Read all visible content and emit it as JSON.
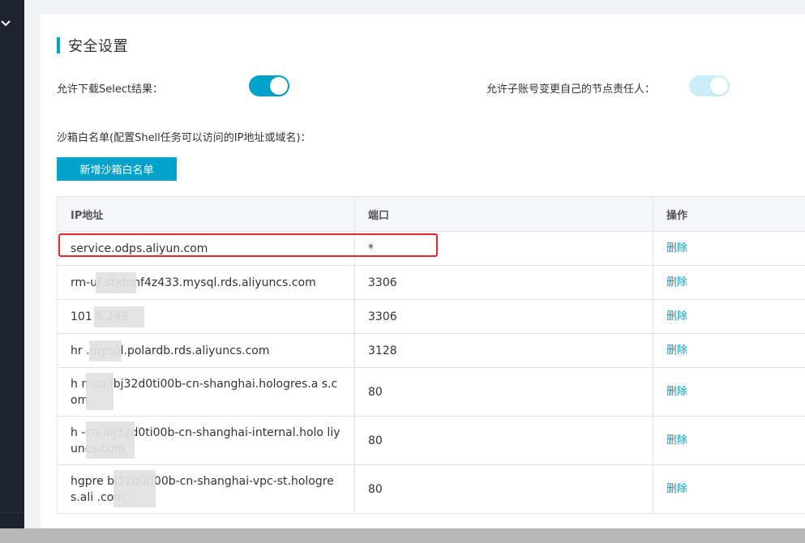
{
  "security": {
    "title": "安全设置",
    "allow_download_label": "允许下载Select结果：",
    "allow_download_on": true,
    "allow_subaccount_label": "允许子账号变更自己的节点责任人：",
    "allow_subaccount_on": true,
    "sandbox_label": "沙箱白名单(配置Shell任务可以访问的IP地址或域名)：",
    "add_button": "新增沙箱白名单"
  },
  "table": {
    "headers": [
      "IP地址",
      "端口",
      "操作"
    ],
    "rows": [
      {
        "ip": "service.odps.aliyun.com",
        "port": "*",
        "action": "删除"
      },
      {
        "ip": "rm-uf        stxhmf4z433.mysql.rds.aliyuncs.com",
        "port": "3306",
        "action": "删除"
      },
      {
        "ip": "101        5.248",
        "port": "3306",
        "action": "删除"
      },
      {
        "ip": "hr        .mysql.polardb.rds.aliyuncs.com",
        "port": "3128",
        "action": "删除"
      },
      {
        "ip": "h        n-cn-lbj32d0ti00b-cn-shanghai.hologres.a        s.com",
        "port": "80",
        "action": "删除"
      },
      {
        "ip": "h        -cn-lbj32d0ti00b-cn-shanghai-internal.holo        liyuncs.com",
        "port": "80",
        "action": "删除"
      },
      {
        "ip": "hgpre        bj32d0ti00b-cn-shanghai-vpc-st.hologres.ali        .com",
        "port": "80",
        "action": "删除"
      }
    ]
  },
  "colors": {
    "accent": "#00a2ca",
    "highlight": "#e8262d",
    "nav_bg": "#1f2330"
  }
}
